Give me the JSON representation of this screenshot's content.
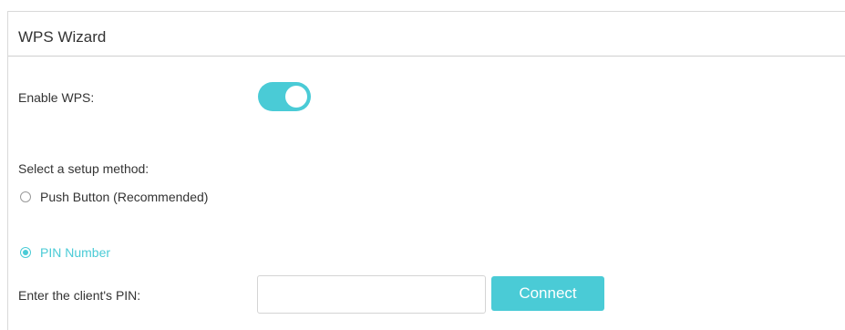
{
  "panel": {
    "title": "WPS Wizard"
  },
  "enable_wps": {
    "label": "Enable WPS:",
    "enabled": true
  },
  "setup": {
    "label": "Select a setup method:",
    "options": [
      {
        "label": "Push Button (Recommended)",
        "selected": false
      },
      {
        "label": "PIN Number",
        "selected": true
      }
    ]
  },
  "pin": {
    "label": "Enter the client's PIN:",
    "value": "",
    "placeholder": ""
  },
  "connect": {
    "label": "Connect"
  },
  "colors": {
    "accent": "#4acbd6",
    "text": "#333333",
    "border": "#d9d9d9"
  }
}
